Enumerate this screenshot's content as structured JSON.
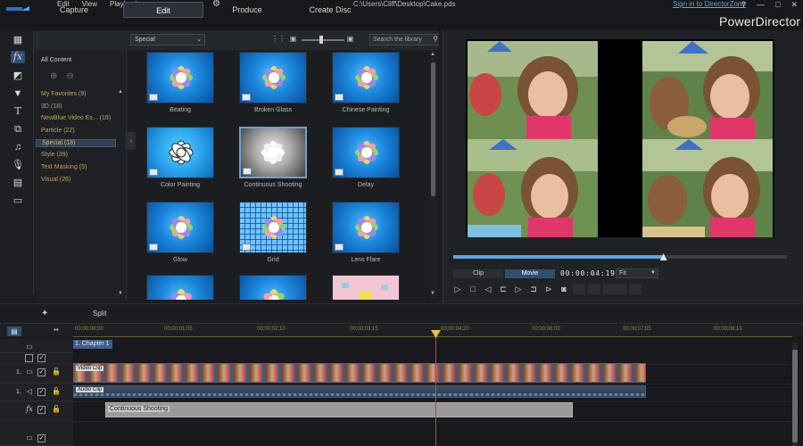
{
  "menu": [
    "Edit",
    "View",
    "Playback"
  ],
  "file_path": "C:\\Users\\Cliff\\Desktop\\Cake.pds",
  "signin": "Sign in to DirectorZone",
  "window_buttons": [
    "?",
    "—",
    "□",
    "✕"
  ],
  "tabs": {
    "capture": "Capture",
    "edit": "Edit",
    "produce": "Produce",
    "create_disc": "Create Disc"
  },
  "brand": "PowerDirector",
  "tools": [
    "media-icon",
    "fx-icon",
    "pip-icon",
    "particle-icon",
    "title-icon",
    "transition-icon",
    "audio-mixing-icon",
    "voice-over-icon",
    "chapter-icon",
    "subtitle-icon"
  ],
  "library": {
    "category_select": "Special",
    "search_placeholder": "Search the library",
    "all_content": "All Content",
    "categories": [
      "My Favorites  (9)",
      "3D  (18)",
      "NewBlue Video Es...  (18)",
      "Particle  (22)",
      "Special  (18)",
      "Style  (39)",
      "Text Masking  (5)",
      "Visual  (26)"
    ],
    "effects": [
      "Beating",
      "Broken Glass",
      "Chinese Painting",
      "Color Painting",
      "Continuous Shooting",
      "Delay",
      "Glow",
      "Grid",
      "Lens Flare"
    ]
  },
  "preview": {
    "mode_clip": "Clip",
    "mode_movie": "Movie",
    "timecode": "00:00:04:19",
    "fit": "Fit",
    "progress": 0.63
  },
  "midstrip": {
    "split": "Split"
  },
  "timeline": {
    "ruler": [
      "00;00;00;00",
      "00;00;01;05",
      "00;00;02;10",
      "00;00;03;15",
      "00;00;04;20",
      "00;00;06;00",
      "00;00;07;05",
      "00;00;08;10"
    ],
    "chapter": "1. Chapter 1",
    "track_video": "1.",
    "track_audio": "1.",
    "track_fx": "fx",
    "video_clip_label": "Video Clip",
    "audio_clip_label": "Audio Clip",
    "fx_clip_label": "Continuous Shooting"
  }
}
